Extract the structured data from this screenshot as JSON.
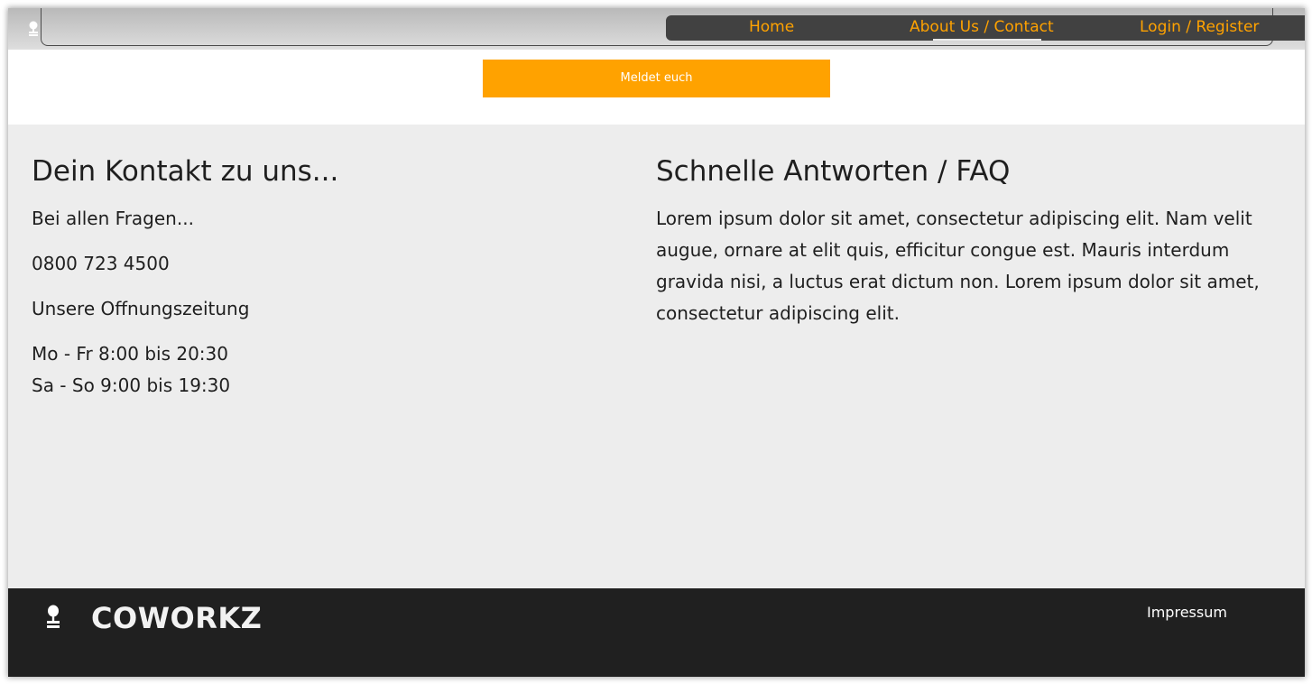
{
  "nav": {
    "home": "Home",
    "about_contact": "About Us / Contact",
    "login_register": "Login / Register"
  },
  "banner": {
    "cta_label": "Meldet euch"
  },
  "contact": {
    "heading": "Dein Kontakt zu uns...",
    "intro": "Bei allen Fragen...",
    "phone": "0800 723 4500",
    "hours_heading": "Unsere Offnungszeitung",
    "hours_weekdays": "Mo - Fr 8:00 bis 20:30",
    "hours_weekend": "Sa - So 9:00 bis 19:30"
  },
  "faq": {
    "heading": "Schnelle Antworten / FAQ",
    "text": "Lorem ipsum dolor sit amet, consectetur adipiscing elit. Nam velit augue, ornare at elit quis, efficitur congue est. Mauris interdum gravida nisi, a luctus erat dictum non. Lorem ipsum dolor sit amet, consectetur adipiscing elit."
  },
  "footer": {
    "brand": "COWORKZ",
    "impressum": "Impressum"
  },
  "colors": {
    "accent": "#ffa200",
    "nav_bg": "#414141",
    "main_bg": "#ededed",
    "footer_bg": "#202020"
  },
  "icons": {
    "logo": "office-chair-icon"
  }
}
